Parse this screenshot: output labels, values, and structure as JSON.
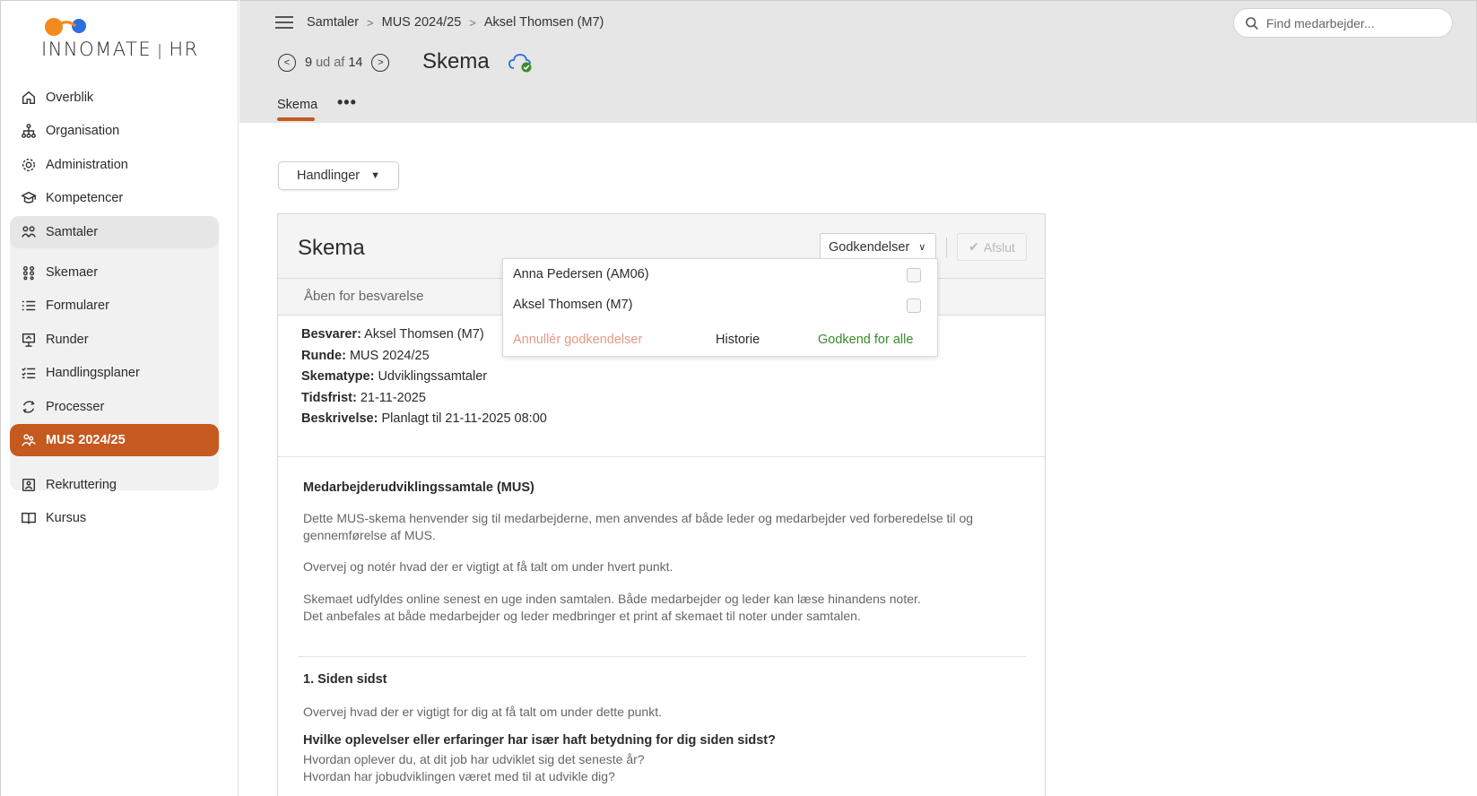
{
  "brand": {
    "name": "INNOMATE",
    "suffix": "HR"
  },
  "sidebar": {
    "items": [
      {
        "label": "Overblik",
        "icon": "home-icon"
      },
      {
        "label": "Organisation",
        "icon": "org-chart-icon"
      },
      {
        "label": "Administration",
        "icon": "gear-icon"
      },
      {
        "label": "Kompetencer",
        "icon": "graduation-cap-icon"
      },
      {
        "label": "Samtaler",
        "icon": "people-icon"
      },
      {
        "label": "Skemaer",
        "icon": "grid-dots-icon"
      },
      {
        "label": "Formularer",
        "icon": "list-icon"
      },
      {
        "label": "Runder",
        "icon": "presentation-icon"
      },
      {
        "label": "Handlingsplaner",
        "icon": "checklist-icon"
      },
      {
        "label": "Processer",
        "icon": "cycle-icon"
      },
      {
        "label": "MUS 2024/25",
        "icon": "people-icon"
      },
      {
        "label": "Rekruttering",
        "icon": "id-card-icon"
      },
      {
        "label": "Kursus",
        "icon": "book-icon"
      }
    ]
  },
  "header": {
    "breadcrumbs": [
      "Samtaler",
      "MUS 2024/25",
      "Aksel Thomsen (M7)"
    ],
    "search_placeholder": "Find medarbejder...",
    "pager": {
      "current": "9",
      "of_label": "ud af",
      "total": "14"
    },
    "title": "Skema",
    "tabs": [
      {
        "label": "Skema"
      }
    ],
    "more_label": "•••"
  },
  "main": {
    "actions_label": "Handlinger",
    "card": {
      "title": "Skema",
      "approvals_label": "Godkendelser",
      "finish_label": "Afslut",
      "status": "Åben for besvarelse",
      "meta": [
        {
          "key": "Besvarer:",
          "value": "Aksel Thomsen (M7)"
        },
        {
          "key": "Runde:",
          "value": "MUS 2024/25"
        },
        {
          "key": "Skematype:",
          "value": "Udviklingssamtaler"
        },
        {
          "key": "Tidsfrist:",
          "value": "21-11-2025"
        },
        {
          "key": "Beskrivelse:",
          "value": "Planlagt til 21-11-2025 08:00"
        }
      ],
      "intro_heading": "Medarbejderudviklingssamtale (MUS)",
      "intro_p1": "Dette MUS-skema henvender sig til medarbejderne, men anvendes af både leder og medarbejder ved forberedelse til og gennemførelse af MUS.",
      "intro_p2": "Overvej og notér hvad der er vigtigt at få talt om under hvert punkt.",
      "intro_p3a": "Skemaet udfyldes online senest en uge inden samtalen. Både medarbejder og leder kan læse hinandens noter.",
      "intro_p3b": "Det anbefales at både medarbejder og leder medbringer et print af skemaet til noter under samtalen.",
      "section1_heading": "1. Siden sidst",
      "section1_text": "Overvej hvad der er vigtigt for dig at få talt om under dette punkt.",
      "section1_question": "Hvilke oplevelser eller erfaringer har især haft betydning for dig siden sidst?",
      "section1_sub1": "Hvordan oplever du, at dit job har udviklet sig det seneste år?",
      "section1_sub2": "Hvordan har jobudviklingen været med til at udvikle dig?"
    }
  },
  "approvals_dropdown": {
    "people": [
      {
        "name": "Anna Pedersen (AM06)",
        "checked": false
      },
      {
        "name": "Aksel Thomsen (M7)",
        "checked": false
      }
    ],
    "cancel_label": "Annullér godkendelser",
    "history_label": "Historie",
    "approve_all_label": "Godkend for alle"
  },
  "colors": {
    "accent": "#c5591f",
    "approve": "#3c8a2e",
    "cancel": "#e39a86",
    "header_bg": "#e6e6e6"
  }
}
